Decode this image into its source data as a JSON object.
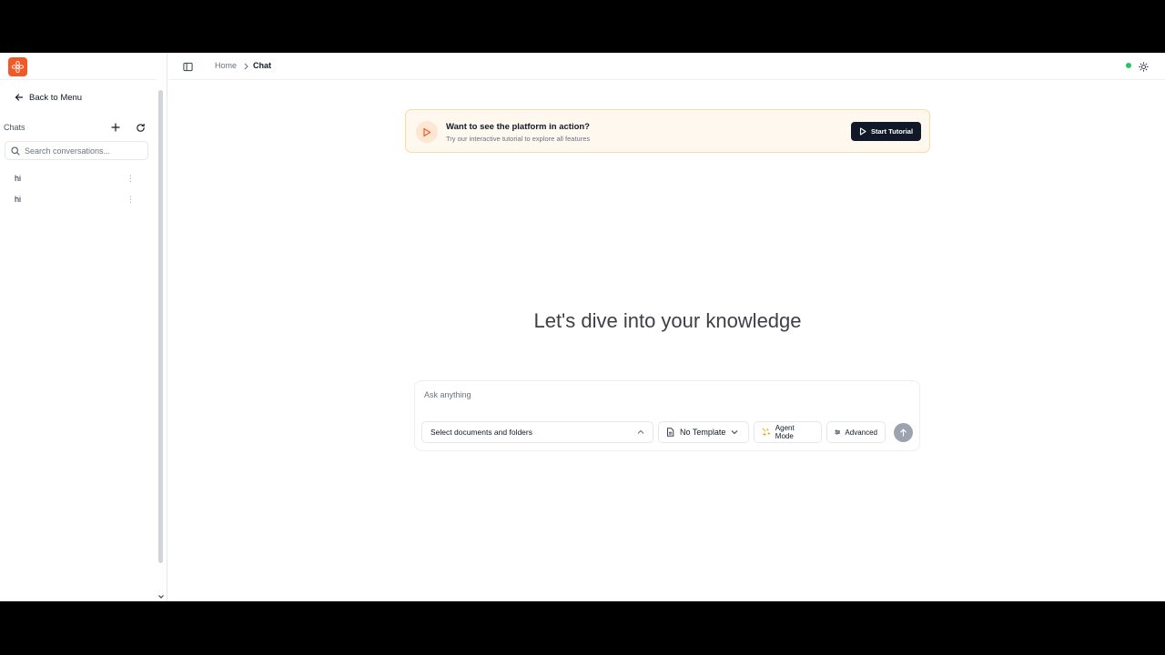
{
  "sidebar": {
    "back_label": "Back to Menu",
    "chats_label": "Chats",
    "search_placeholder": "Search conversations...",
    "chats": [
      {
        "title": "hi"
      },
      {
        "title": "hi"
      }
    ]
  },
  "header": {
    "breadcrumb": [
      "Home",
      "Chat"
    ]
  },
  "banner": {
    "title": "Want to see the platform in action?",
    "subtitle": "Try our interactive tutorial to explore all features",
    "button_label": "Start Tutorial"
  },
  "main": {
    "heading": "Let's dive into your knowledge"
  },
  "composer": {
    "placeholder": "Ask anything",
    "documents_label": "Select documents and folders",
    "template_label": "No Template",
    "agent_mode_label": "Agent Mode",
    "advanced_label": "Advanced"
  },
  "colors": {
    "brand": "#f05a28",
    "status_online": "#22c55e",
    "banner_bg": "#fff8ee",
    "button_dark": "#111827"
  },
  "icons": {
    "logo": "flower-logo-icon",
    "sidebar_toggle": "panel-left-icon",
    "theme": "sun-icon",
    "send": "arrow-up-icon"
  }
}
